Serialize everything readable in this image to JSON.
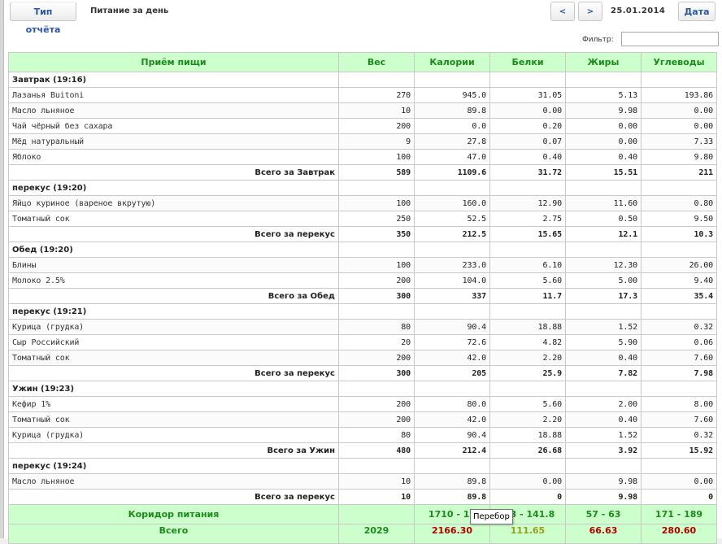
{
  "toolbar": {
    "report_type": "Тип отчёта",
    "title": "Питание за день",
    "prev": "<",
    "next": ">",
    "date": "25.01.2014",
    "date_button": "Дата"
  },
  "filter": {
    "label": "Фильтр:",
    "value": ""
  },
  "columns": [
    "Приём пищи",
    "Вес",
    "Калории",
    "Белки",
    "Жиры",
    "Углеводы"
  ],
  "meals": [
    {
      "title": "Завтрак (19:16)",
      "items": [
        [
          "Лазанья Buitoni",
          "270",
          "945.0",
          "31.05",
          "5.13",
          "193.86"
        ],
        [
          "Масло льняное",
          "10",
          "89.8",
          "0.00",
          "9.98",
          "0.00"
        ],
        [
          "Чай чёрный без сахара",
          "200",
          "0.0",
          "0.20",
          "0.00",
          "0.00"
        ],
        [
          "Мёд натуральный",
          "9",
          "27.8",
          "0.07",
          "0.00",
          "7.33"
        ],
        [
          "Яблоко",
          "100",
          "47.0",
          "0.40",
          "0.40",
          "9.80"
        ]
      ],
      "total": [
        "Всего за Завтрак",
        "589",
        "1109.6",
        "31.72",
        "15.51",
        "211"
      ]
    },
    {
      "title": "перекус (19:20)",
      "items": [
        [
          "Яйцо куриное (вареное вкрутую)",
          "100",
          "160.0",
          "12.90",
          "11.60",
          "0.80"
        ],
        [
          "Томатный сок",
          "250",
          "52.5",
          "2.75",
          "0.50",
          "9.50"
        ]
      ],
      "total": [
        "Всего за перекус",
        "350",
        "212.5",
        "15.65",
        "12.1",
        "10.3"
      ]
    },
    {
      "title": "Обед (19:20)",
      "items": [
        [
          "Блины",
          "100",
          "233.0",
          "6.10",
          "12.30",
          "26.00"
        ],
        [
          "Молоко 2.5%",
          "200",
          "104.0",
          "5.60",
          "5.00",
          "9.40"
        ]
      ],
      "total": [
        "Всего за Обед",
        "300",
        "337",
        "11.7",
        "17.3",
        "35.4"
      ]
    },
    {
      "title": "перекус (19:21)",
      "items": [
        [
          "Курица (грудка)",
          "80",
          "90.4",
          "18.88",
          "1.52",
          "0.32"
        ],
        [
          "Сыр Российский",
          "20",
          "72.6",
          "4.82",
          "5.90",
          "0.06"
        ],
        [
          "Томатный сок",
          "200",
          "42.0",
          "2.20",
          "0.40",
          "7.60"
        ]
      ],
      "total": [
        "Всего за перекус",
        "300",
        "205",
        "25.9",
        "7.82",
        "7.98"
      ]
    },
    {
      "title": "Ужин (19:23)",
      "items": [
        [
          "Кефир 1%",
          "200",
          "80.0",
          "5.60",
          "2.00",
          "8.00"
        ],
        [
          "Томатный сок",
          "200",
          "42.0",
          "2.20",
          "0.40",
          "7.60"
        ],
        [
          "Курица (грудка)",
          "80",
          "90.4",
          "18.88",
          "1.52",
          "0.32"
        ]
      ],
      "total": [
        "Всего за Ужин",
        "480",
        "212.4",
        "26.68",
        "3.92",
        "15.92"
      ]
    },
    {
      "title": "перекус (19:24)",
      "items": [
        [
          "Масло льняное",
          "10",
          "89.8",
          "0.00",
          "9.98",
          "0.00"
        ]
      ],
      "total": [
        "Всего за перекус",
        "10",
        "89.8",
        "0",
        "9.98",
        "0"
      ]
    }
  ],
  "corridor": {
    "label": "Коридор питания",
    "values": [
      "",
      "1710 - 18",
      "3.3 - 141.8",
      "57 - 63",
      "171 - 189"
    ]
  },
  "grand_total": {
    "label": "Всего",
    "values": [
      "2029",
      "2166.30",
      "111.65",
      "66.63",
      "280.60"
    ]
  },
  "grand_total_colors": [
    "#1c8a1c",
    "#b30000",
    "#9c9c1a",
    "#b30000",
    "#b30000"
  ],
  "tooltip": "Перебор"
}
